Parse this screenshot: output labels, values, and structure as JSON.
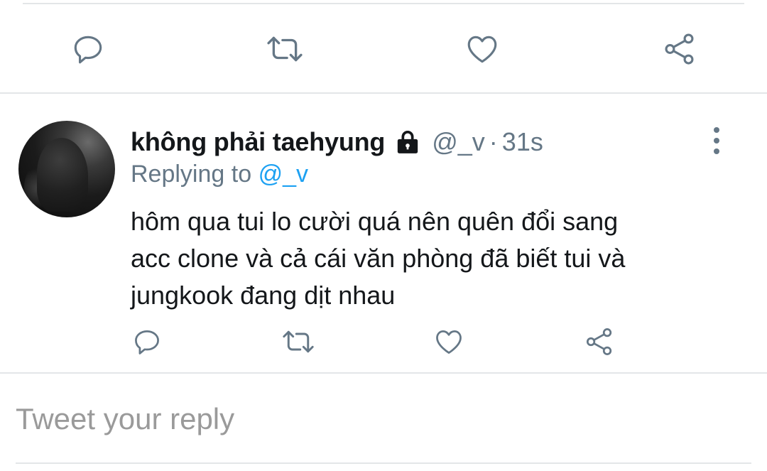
{
  "colors": {
    "primary_text": "#14171a",
    "secondary_text": "#657786",
    "link": "#1da1f2",
    "divider": "#e3e6e8",
    "placeholder": "#9a9a9a"
  },
  "top_actions": [
    "reply-icon",
    "retweet-icon",
    "like-icon",
    "share-icon"
  ],
  "tweet": {
    "display_name": "không phải taehyung",
    "protected_icon": "lock-icon",
    "handle": "@_v",
    "separator": "·",
    "time": "31s",
    "replying_prefix": "Replying to",
    "replying_handle": "@_v",
    "text_lines": [
      "hôm qua tui lo cười quá nên quên đổi sang",
      "acc clone và cả cái văn phòng đã biết tui và",
      "jungkook đang dịt nhau"
    ],
    "actions": [
      "reply-icon",
      "retweet-icon",
      "like-icon",
      "share-icon"
    ]
  },
  "compose": {
    "placeholder": "Tweet your reply"
  }
}
